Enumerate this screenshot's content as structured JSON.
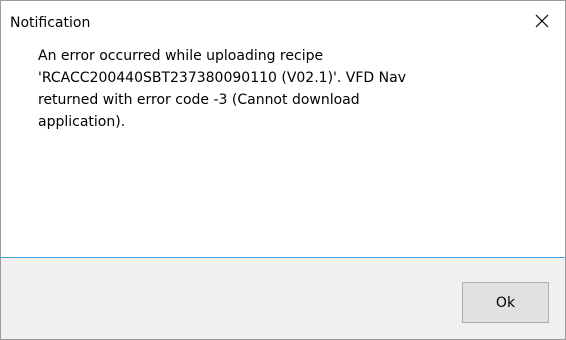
{
  "dialog": {
    "title": "Notification",
    "close_icon": "close-icon",
    "message": "An error occurred while uploading recipe\n'RCACC200440SBT237380090110 (V02.1)'. VFD Nav\nreturned with error code -3 (Cannot download\napplication).",
    "ok_label": "Ok"
  },
  "colors": {
    "accent_divider": "#3aa1e0",
    "footer_background": "#f0f0f0",
    "button_background": "#e1e1e1"
  }
}
